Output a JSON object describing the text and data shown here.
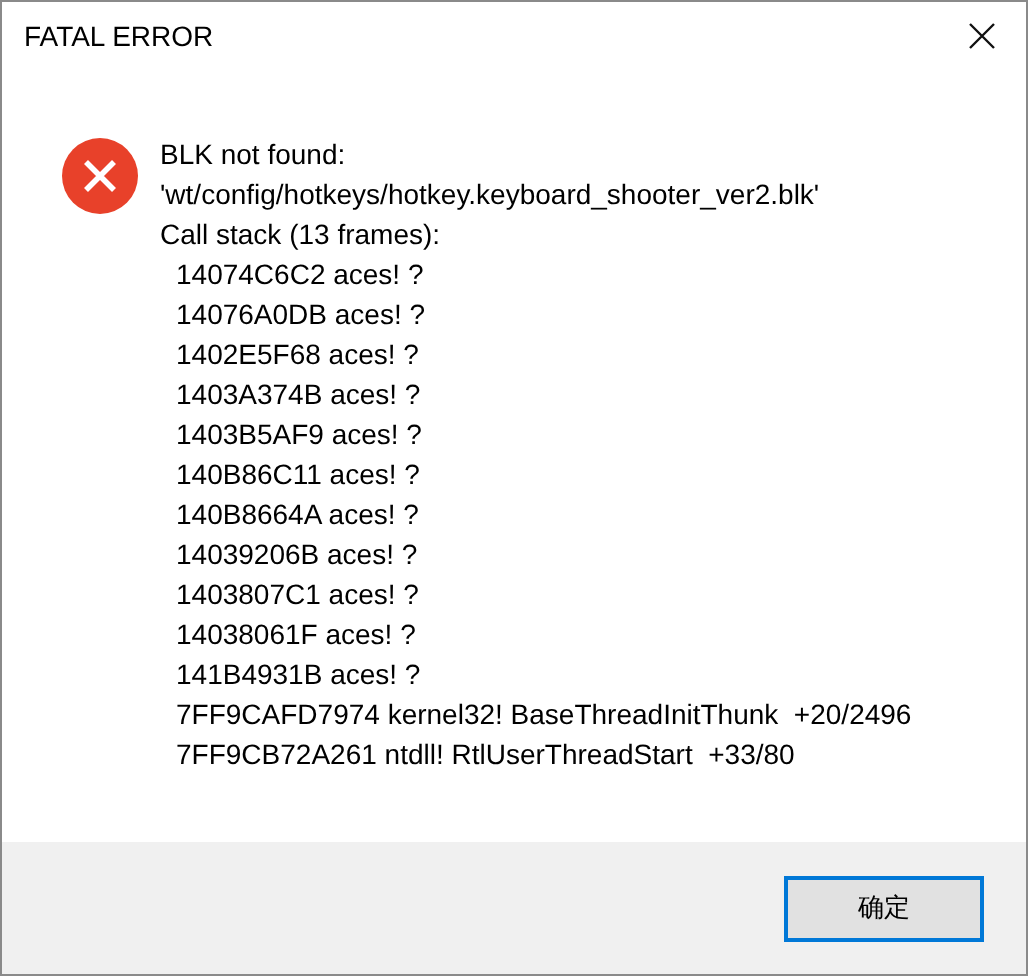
{
  "window": {
    "title": "FATAL ERROR"
  },
  "message": [
    "BLK not found:",
    "'wt/config/hotkeys/hotkey.keyboard_shooter_ver2.blk'",
    "Call stack (13 frames):"
  ],
  "call_stack": [
    "14074C6C2 aces! ?",
    "14076A0DB aces! ?",
    "1402E5F68 aces! ?",
    "1403A374B aces! ?",
    "1403B5AF9 aces! ?",
    "140B86C11 aces! ?",
    "140B8664A aces! ?",
    "14039206B aces! ?",
    "1403807C1 aces! ?",
    "14038061F aces! ?",
    "141B4931B aces! ?",
    "7FF9CAFD7974 kernel32! BaseThreadInitThunk  +20/2496",
    "7FF9CB72A261 ntdll! RtlUserThreadStart  +33/80"
  ],
  "buttons": [
    {
      "label": "确定",
      "focused": true
    }
  ]
}
